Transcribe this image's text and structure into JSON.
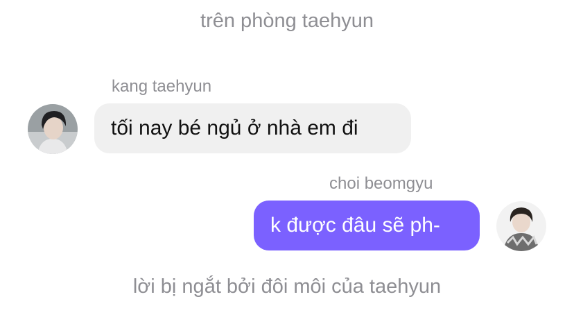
{
  "narration_top": "trên phòng taehyun",
  "messages": [
    {
      "sender": "kang taehyun",
      "text": "tối nay bé ngủ ở nhà em đi",
      "side": "left",
      "bubble_color": "#f0f0f0"
    },
    {
      "sender": "choi beomgyu",
      "text": "k được đâu sẽ ph-",
      "side": "right",
      "bubble_color": "#7b61ff"
    }
  ],
  "narration_bottom": "lời bị ngắt bởi đôi môi của taehyun"
}
